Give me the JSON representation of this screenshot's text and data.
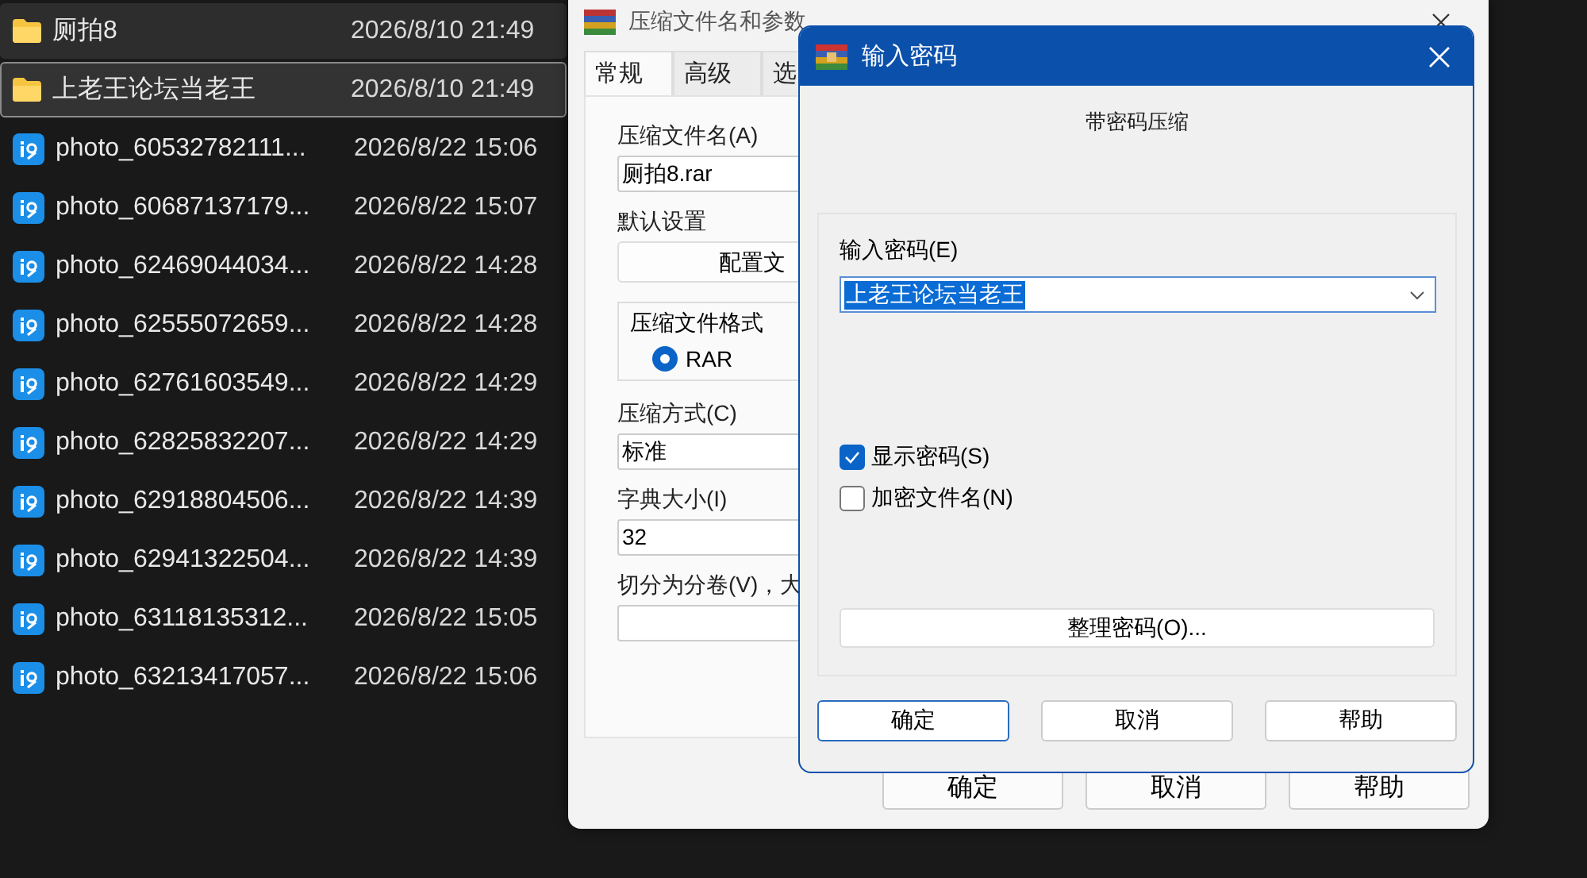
{
  "files": [
    {
      "kind": "folder",
      "name": "厕拍8",
      "modified": "2026/8/10 21:49",
      "hovered": true,
      "selected": false
    },
    {
      "kind": "folder",
      "name": "上老王论坛当老王",
      "modified": "2026/8/10 21:49",
      "hovered": false,
      "selected": true
    },
    {
      "kind": "image",
      "name": "photo_60532782111...",
      "modified": "2026/8/22 15:06",
      "hovered": false,
      "selected": false
    },
    {
      "kind": "image",
      "name": "photo_60687137179...",
      "modified": "2026/8/22 15:07",
      "hovered": false,
      "selected": false
    },
    {
      "kind": "image",
      "name": "photo_62469044034...",
      "modified": "2026/8/22 14:28",
      "hovered": false,
      "selected": false
    },
    {
      "kind": "image",
      "name": "photo_62555072659...",
      "modified": "2026/8/22 14:28",
      "hovered": false,
      "selected": false
    },
    {
      "kind": "image",
      "name": "photo_62761603549...",
      "modified": "2026/8/22 14:29",
      "hovered": false,
      "selected": false
    },
    {
      "kind": "image",
      "name": "photo_62825832207...",
      "modified": "2026/8/22 14:29",
      "hovered": false,
      "selected": false
    },
    {
      "kind": "image",
      "name": "photo_62918804506...",
      "modified": "2026/8/22 14:39",
      "hovered": false,
      "selected": false
    },
    {
      "kind": "image",
      "name": "photo_62941322504...",
      "modified": "2026/8/22 14:39",
      "hovered": false,
      "selected": false
    },
    {
      "kind": "image",
      "name": "photo_63118135312...",
      "modified": "2026/8/22 15:05",
      "hovered": false,
      "selected": false
    },
    {
      "kind": "image",
      "name": "photo_63213417057...",
      "modified": "2026/8/22 15:06",
      "hovered": false,
      "selected": false
    }
  ],
  "archive_window": {
    "title": "压缩文件名和参数",
    "tabs": [
      {
        "label": "常规",
        "selected": true
      },
      {
        "label": "高级",
        "selected": false
      },
      {
        "label": "选",
        "selected": false
      }
    ],
    "archive_name_label": "压缩文件名(A)",
    "archive_name": "厕拍8.rar",
    "default_settings_label": "默认设置",
    "profiles_button": "配置文",
    "format_group_label": "压缩文件格式",
    "formats": [
      {
        "label": "RAR",
        "selected": true
      }
    ],
    "method_label": "压缩方式(C)",
    "method": "标准",
    "dictionary_label": "字典大小(I)",
    "dictionary": "32",
    "split_label": "切分为分卷(V)，大",
    "buttons": [
      "确定",
      "取消",
      "帮助"
    ]
  },
  "password_dialog": {
    "title": "输入密码",
    "heading": "带密码压缩",
    "password_label": "输入密码(E)",
    "password": "上老王论坛当老王",
    "password_text_selected": true,
    "options": [
      {
        "label": "显示密码(S)",
        "checked": true
      },
      {
        "label": "加密文件名(N)",
        "checked": false
      }
    ],
    "organize_button": "整理密码(O)...",
    "buttons": [
      {
        "label": "确定",
        "default": true
      },
      {
        "label": "取消",
        "default": false
      },
      {
        "label": "帮助",
        "default": false
      }
    ]
  }
}
